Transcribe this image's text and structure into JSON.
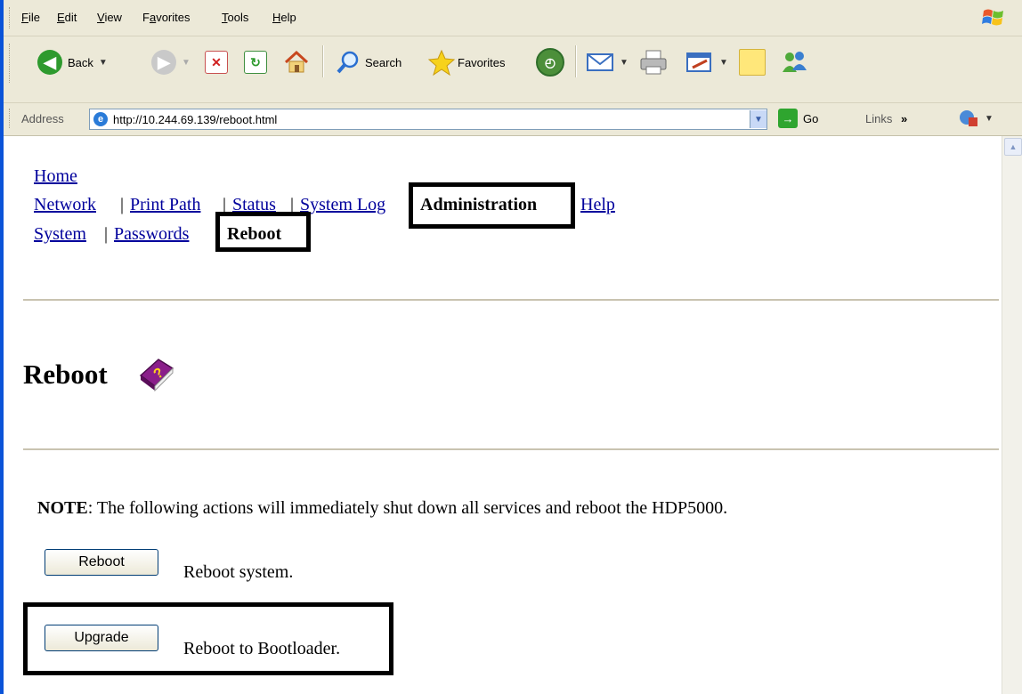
{
  "menu": {
    "items": [
      {
        "label": "File",
        "accel": "F",
        "rest": "ile"
      },
      {
        "label": "Edit",
        "accel": "E",
        "rest": "dit"
      },
      {
        "label": "View",
        "accel": "V",
        "rest": "iew"
      },
      {
        "label": "Favorites",
        "accel": "a",
        "pre": "F",
        "rest": "vorites"
      },
      {
        "label": "Tools",
        "accel": "T",
        "rest": "ools"
      },
      {
        "label": "Help",
        "accel": "H",
        "rest": "elp"
      }
    ]
  },
  "toolbar": {
    "back_label": "Back",
    "search_label": "Search",
    "favorites_label": "Favorites"
  },
  "address": {
    "label": "Address",
    "url": "http://10.244.69.139/reboot.html",
    "go_label": "Go",
    "links_label": "Links",
    "links_chevron": "»"
  },
  "nav": {
    "home": "Home",
    "row2": [
      "Network",
      "Print Path",
      "Status",
      "System Log"
    ],
    "current_section": "Administration",
    "help": "Help",
    "row3": [
      "System",
      "Passwords"
    ],
    "current_page": "Reboot",
    "separator": "|"
  },
  "page": {
    "heading": "Reboot",
    "note_label": "NOTE",
    "note_text": ": The following actions will immediately shut down all services and reboot the HDP5000.",
    "reboot_button": "Reboot",
    "reboot_desc": "Reboot system.",
    "upgrade_button": "Upgrade",
    "upgrade_desc": "Reboot to Bootloader."
  }
}
